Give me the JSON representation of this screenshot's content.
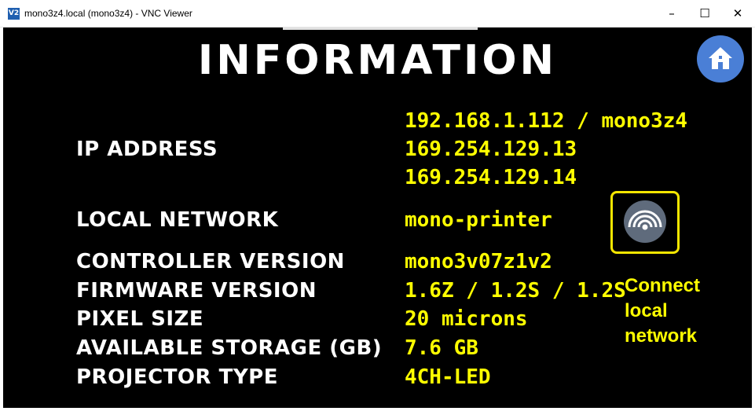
{
  "window": {
    "app_icon": "V2",
    "title": "mono3z4.local (mono3z4) - VNC Viewer",
    "minimize": "–",
    "maximize": "☐",
    "close": "✕"
  },
  "page": {
    "heading": "INFORMATION",
    "home_icon": "home-icon"
  },
  "info": {
    "ip_label": "IP ADDRESS",
    "ip_values": [
      "192.168.1.112 / mono3z4",
      "169.254.129.13",
      "169.254.129.14"
    ],
    "local_network_label": "LOCAL NETWORK",
    "local_network_value": "mono-printer",
    "controller_label": "CONTROLLER VERSION",
    "controller_value": "mono3v07z1v2",
    "firmware_label": "FIRMWARE VERSION",
    "firmware_value": "1.6Z / 1.2S / 1.2S",
    "pixel_label": "PIXEL SIZE",
    "pixel_value": "20 microns",
    "storage_label": "AVAILABLE STORAGE (GB)",
    "storage_value": "7.6 GB",
    "projector_label": "PROJECTOR TYPE",
    "projector_value": "4CH-LED"
  },
  "connect": {
    "icon": "wireless-signal-icon",
    "lines": [
      "Connect",
      "local",
      "network"
    ]
  },
  "colors": {
    "value_yellow": "#ffff00",
    "home_blue": "#4a7fd6",
    "button_border": "#f5e600"
  }
}
